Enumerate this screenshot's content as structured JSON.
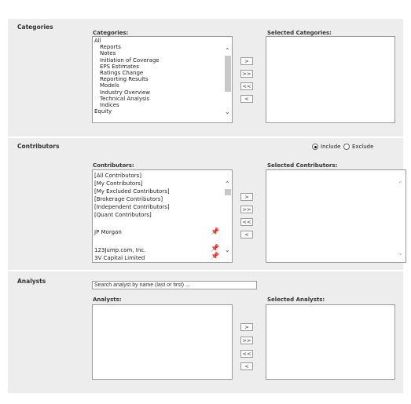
{
  "categories": {
    "section_title": "Categories",
    "list_label": "Categories:",
    "selected_label": "Selected Categories:",
    "items": [
      {
        "label": "All",
        "indent": false
      },
      {
        "label": "Reports",
        "indent": true
      },
      {
        "label": "Notes",
        "indent": true
      },
      {
        "label": "Initiation of Coverage",
        "indent": true
      },
      {
        "label": "EPS Estimates",
        "indent": true
      },
      {
        "label": "Ratings Change",
        "indent": true
      },
      {
        "label": "Reporting Results",
        "indent": true
      },
      {
        "label": "Models",
        "indent": true
      },
      {
        "label": "Industry Overview",
        "indent": true
      },
      {
        "label": "Technical Analysis",
        "indent": true
      },
      {
        "label": "Indices",
        "indent": true
      },
      {
        "label": "Equity",
        "indent": false
      }
    ],
    "buttons": [
      ">",
      ">>",
      "<<",
      "<"
    ]
  },
  "contributors": {
    "section_title": "Contributors",
    "list_label": "Contributors:",
    "selected_label": "Selected Contributors:",
    "include_label": "Include",
    "exclude_label": "Exclude",
    "mode": "include",
    "items": [
      "[All Contributors]",
      "[My Contributors]",
      "[My Excluded Contributors]",
      "[Brokerage Contributors]",
      "[Independent Contributors]",
      "[Quant Contributors]"
    ],
    "pinned": "JP Morgan",
    "more": [
      "123Jump.com, Inc.",
      "3V Capital Limited"
    ],
    "buttons": [
      ">",
      ">>",
      "<<",
      "<"
    ]
  },
  "analysts": {
    "section_title": "Analysts",
    "search_placeholder": "Search analyst by name (last or first) ...",
    "list_label": "Analysts:",
    "selected_label": "Selected Analysts:",
    "buttons": [
      ">",
      ">>",
      "<<",
      "<"
    ]
  }
}
